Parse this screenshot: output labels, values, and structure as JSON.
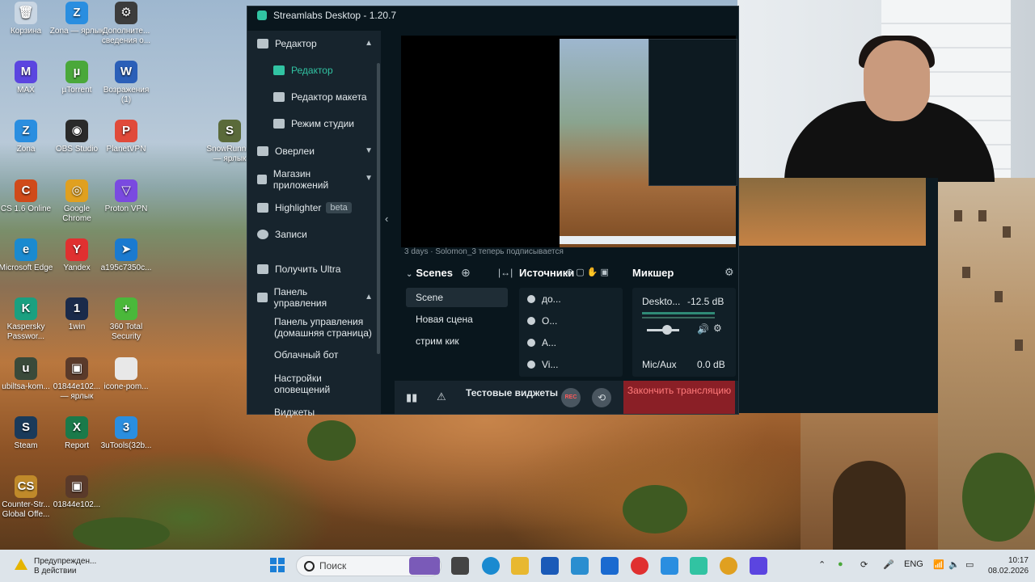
{
  "desktop_icons": [
    {
      "label": "Корзина",
      "color": "#c9d6e3",
      "glyph": "🗑"
    },
    {
      "label": "Zona — ярлык",
      "color": "#2a8ee0",
      "glyph": "Z"
    },
    {
      "label": "Дополните... сведения о...",
      "color": "#3c3c3c",
      "glyph": "⚙"
    },
    {
      "label": "MAX",
      "color": "#5b45e0",
      "glyph": "M"
    },
    {
      "label": "µTorrent",
      "color": "#4aa83a",
      "glyph": "µ"
    },
    {
      "label": "Возражения (1)",
      "color": "#2b5fb8",
      "glyph": "W"
    },
    {
      "label": "Zona",
      "color": "#2a8ee0",
      "glyph": "Z"
    },
    {
      "label": "OBS Studio",
      "color": "#2a2a2a",
      "glyph": "◉"
    },
    {
      "label": "PlanetVPN",
      "color": "#e04a3a",
      "glyph": "P"
    },
    {
      "label": "SnowRunn... — ярлык",
      "color": "#5a6a3a",
      "glyph": "S"
    },
    {
      "label": "CS 1.6 Online",
      "color": "#d04a1a",
      "glyph": "C"
    },
    {
      "label": "Google Chrome",
      "color": "#e0a020",
      "glyph": "◎"
    },
    {
      "label": "Proton VPN",
      "color": "#7a4ae0",
      "glyph": "▽"
    },
    {
      "label": "Microsoft Edge",
      "color": "#1a8ad0",
      "glyph": "e"
    },
    {
      "label": "Yandex",
      "color": "#e03030",
      "glyph": "Y"
    },
    {
      "label": "a195c7350c...",
      "color": "#1a7ad0",
      "glyph": "➤"
    },
    {
      "label": "Kaspersky Passwor...",
      "color": "#1aa080",
      "glyph": "K"
    },
    {
      "label": "1win",
      "color": "#1a2a4a",
      "glyph": "1"
    },
    {
      "label": "360 Total Security",
      "color": "#4ab83a",
      "glyph": "+"
    },
    {
      "label": "ubiltsa-kom...",
      "color": "#3a4a3a",
      "glyph": "u"
    },
    {
      "label": "01844e102... — ярлык",
      "color": "#5a3a2a",
      "glyph": "▣"
    },
    {
      "label": "icone-pom...",
      "color": "#e8e8e8",
      "glyph": ""
    },
    {
      "label": "Steam",
      "color": "#1a3a5a",
      "glyph": "S"
    },
    {
      "label": "Report",
      "color": "#1a7a4a",
      "glyph": "X"
    },
    {
      "label": "3uTools(32b...",
      "color": "#2a8ee0",
      "glyph": "3"
    },
    {
      "label": "Counter-Str... Global Offe...",
      "color": "#c08a2a",
      "glyph": "CS"
    },
    {
      "label": "01844e102...",
      "color": "#5a3a2a",
      "glyph": "▣"
    }
  ],
  "app": {
    "title": "Streamlabs Desktop - 1.20.7",
    "sidebar": {
      "editor_group": "Редактор",
      "editor": "Редактор",
      "layout_editor": "Редактор макета",
      "studio_mode": "Режим студии",
      "overlays": "Оверлеи",
      "app_store": "Магазин приложений",
      "highlighter": "Highlighter",
      "highlighter_badge": "beta",
      "recordings": "Записи",
      "ultra": "Получить Ultra",
      "dashboard": "Панель управления",
      "dashboard_home": "Панель управления (домашняя страница)",
      "cloudbot": "Облачный бот",
      "alerts": "Настройки оповещений",
      "widgets": "Виджеты"
    },
    "preview_text": "3 days · Solomon_3 теперь подписывается",
    "scenes": {
      "title": "Scenes",
      "items": [
        "Scene",
        "Новая сцена",
        "стрим кик"
      ],
      "selected": 0
    },
    "sources": {
      "title": "Источники",
      "items": [
        "до...",
        "О...",
        "А...",
        "Vi..."
      ]
    },
    "mixer": {
      "title": "Микшер",
      "desktop_label": "Deskto...",
      "desktop_db": "-12.5 dB",
      "mic_label": "Mic/Aux",
      "mic_db": "0.0 dB"
    },
    "footer": {
      "test_widgets": "Тестовые виджеты",
      "rec": "REC",
      "end_stream": "Закончить трансляцию"
    }
  },
  "taskbar": {
    "warning_title": "Предупрежден...",
    "warning_sub": "В действии",
    "search_placeholder": "Поиск",
    "lang": "ENG",
    "time": "10:17",
    "date": "08.02.2026"
  }
}
